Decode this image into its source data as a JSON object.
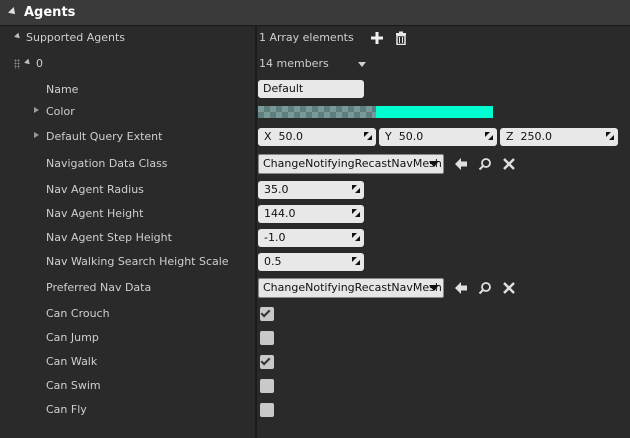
{
  "header": {
    "title": "Agents"
  },
  "array": {
    "label": "Supported Agents",
    "count_text": "1 Array elements",
    "item_index": "0",
    "members_text": "14 members"
  },
  "rows": {
    "name": {
      "label": "Name",
      "value": "Default"
    },
    "color": {
      "label": "Color",
      "color_hex": "#00ffd0"
    },
    "query_extent": {
      "label": "Default Query Extent",
      "x_label": "X",
      "x": "50.0",
      "y_label": "Y",
      "y": "50.0",
      "z_label": "Z",
      "z": "250.0"
    },
    "nav_data_class": {
      "label": "Navigation Data Class",
      "value": "ChangeNotifyingRecastNavMesh"
    },
    "radius": {
      "label": "Nav Agent Radius",
      "value": "35.0"
    },
    "height": {
      "label": "Nav Agent Height",
      "value": "144.0"
    },
    "step_height": {
      "label": "Nav Agent Step Height",
      "value": "-1.0"
    },
    "walking_scale": {
      "label": "Nav Walking Search Height Scale",
      "value": "0.5"
    },
    "preferred_nav": {
      "label": "Preferred Nav Data",
      "value": "ChangeNotifyingRecastNavMesh"
    },
    "can_crouch": {
      "label": "Can Crouch",
      "checked": true
    },
    "can_jump": {
      "label": "Can Jump",
      "checked": false
    },
    "can_walk": {
      "label": "Can Walk",
      "checked": true
    },
    "can_swim": {
      "label": "Can Swim",
      "checked": false
    },
    "can_fly": {
      "label": "Can Fly",
      "checked": false
    }
  },
  "icons": {
    "add": "plus-icon",
    "delete": "trash-icon",
    "use": "arrow-left-icon",
    "browse": "magnifier-icon",
    "clear": "close-icon"
  }
}
